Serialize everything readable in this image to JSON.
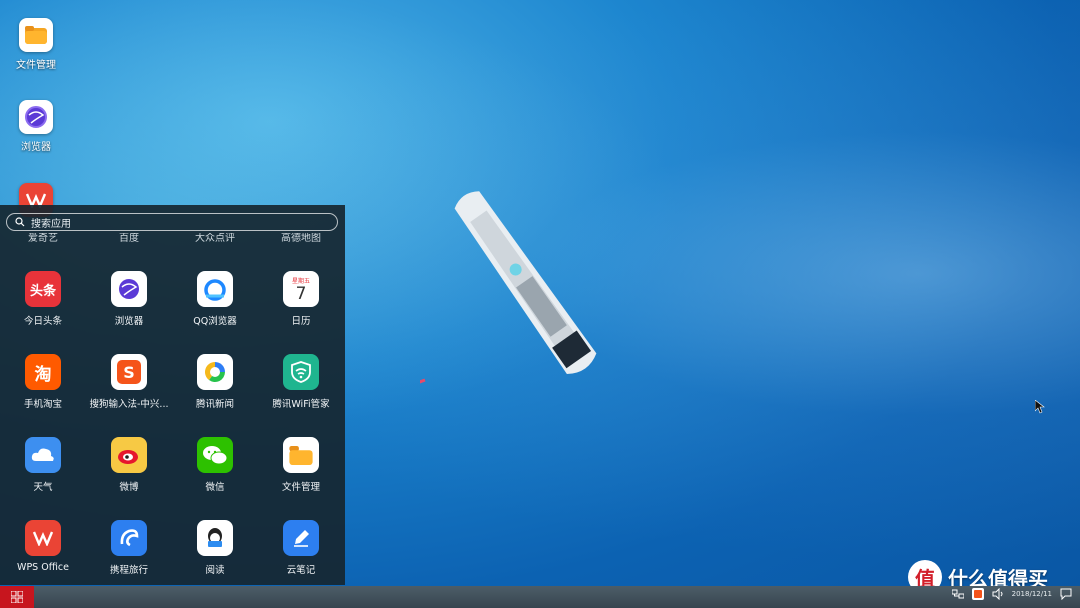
{
  "desktop": {
    "icons": [
      {
        "label": "文件管理",
        "icon": "folder-icon"
      },
      {
        "label": "浏览器",
        "icon": "browser-globe-icon"
      },
      {
        "label": "",
        "icon": "wps-icon"
      }
    ]
  },
  "start_menu": {
    "search_placeholder": "搜索应用",
    "cut_row": [
      "爱奇艺",
      "百度",
      "大众点评",
      "高德地图"
    ],
    "apps": [
      {
        "label": "今日头条",
        "icon": "toutiao-icon",
        "glyph": "头条",
        "bg": "#e8333a"
      },
      {
        "label": "浏览器",
        "icon": "browser-globe-icon",
        "glyph": "",
        "bg": "#ffffff"
      },
      {
        "label": "QQ浏览器",
        "icon": "qq-browser-icon",
        "glyph": "",
        "bg": "#ffffff"
      },
      {
        "label": "日历",
        "icon": "calendar-icon",
        "glyph": "7",
        "sub": "星期五",
        "bg": "#ffffff"
      },
      {
        "label": "手机淘宝",
        "icon": "taobao-icon",
        "glyph": "淘",
        "bg": "#ff5a00"
      },
      {
        "label": "搜狗输入法-中兴...",
        "icon": "sogou-input-icon",
        "glyph": "S",
        "bg": "#ffffff"
      },
      {
        "label": "腾讯新闻",
        "icon": "tencent-news-icon",
        "glyph": "",
        "bg": "#ffffff"
      },
      {
        "label": "腾讯WiFi管家",
        "icon": "tencent-wifi-icon",
        "glyph": "",
        "bg": "#1fb58f"
      },
      {
        "label": "天气",
        "icon": "weather-icon",
        "glyph": "",
        "bg": "#3d8ff0"
      },
      {
        "label": "微博",
        "icon": "weibo-icon",
        "glyph": "",
        "bg": "#f7c944"
      },
      {
        "label": "微信",
        "icon": "wechat-icon",
        "glyph": "",
        "bg": "#2dc100"
      },
      {
        "label": "文件管理",
        "icon": "folder-icon",
        "glyph": "",
        "bg": "#ffffff"
      },
      {
        "label": "WPS Office",
        "icon": "wps-icon",
        "glyph": "W",
        "bg": "#ea4435"
      },
      {
        "label": "携程旅行",
        "icon": "ctrip-icon",
        "glyph": "",
        "bg": "#2d7ff0"
      },
      {
        "label": "阅读",
        "icon": "reader-icon",
        "glyph": "",
        "bg": "#ffffff"
      },
      {
        "label": "云笔记",
        "icon": "cloud-note-icon",
        "glyph": "",
        "bg": "#2d7ff0"
      }
    ]
  },
  "taskbar": {
    "date": "2018/12/11"
  },
  "watermark": {
    "badge": "值",
    "text": "什么值得买"
  }
}
